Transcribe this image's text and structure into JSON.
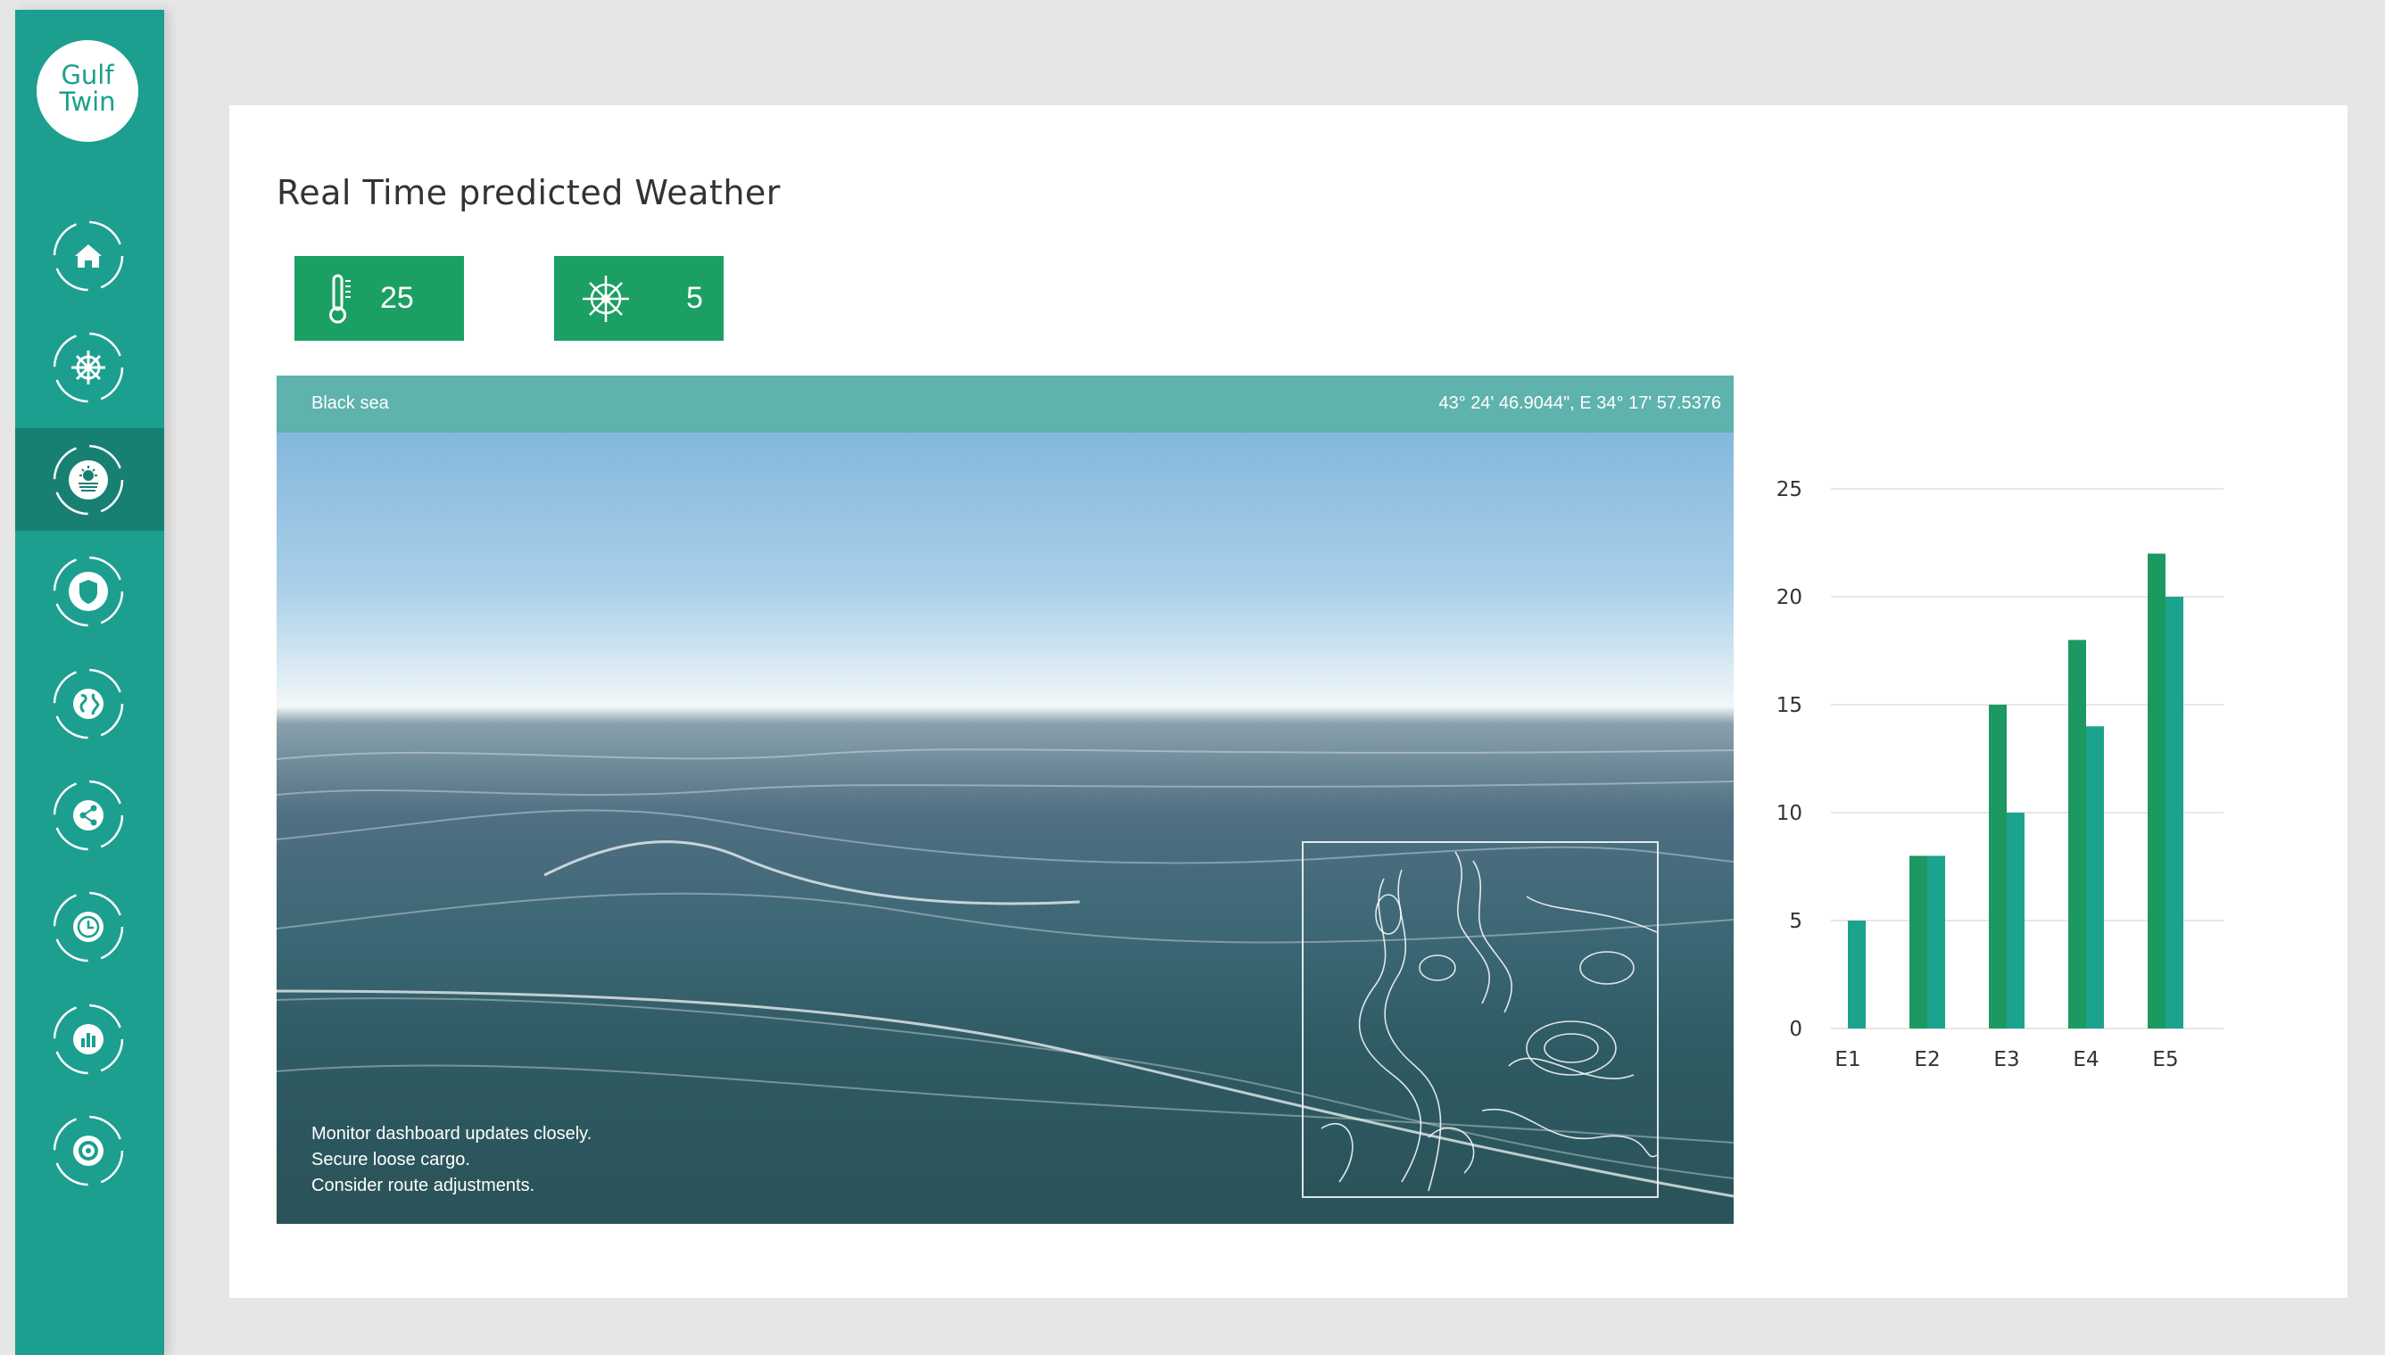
{
  "app": {
    "logo_line1": "Gulf",
    "logo_line2": "Twin"
  },
  "sidebar": {
    "items": [
      {
        "icon": "home-icon",
        "active": false
      },
      {
        "icon": "ship-wheel-icon",
        "active": false
      },
      {
        "icon": "weather-sun-icon",
        "active": true
      },
      {
        "icon": "shield-icon",
        "active": false
      },
      {
        "icon": "globe-icon",
        "active": false
      },
      {
        "icon": "share-icon",
        "active": false
      },
      {
        "icon": "clock-icon",
        "active": false
      },
      {
        "icon": "bar-chart-icon",
        "active": false
      },
      {
        "icon": "gear-icon",
        "active": false
      }
    ]
  },
  "main": {
    "title": "Real Time predicted Weather",
    "metrics": {
      "temperature": {
        "icon": "thermometer-icon",
        "value": "25"
      },
      "wind": {
        "icon": "ship-wheel-icon",
        "value": "5"
      }
    },
    "sea_view": {
      "location": "Black sea",
      "coordinates": "43° 24' 46.9044\", E 34° 17' 57.5376",
      "advice": [
        "Monitor dashboard updates closely.",
        "Secure loose cargo.",
        "Consider route adjustments."
      ]
    }
  },
  "colors": {
    "sidebar": "#1c9f8f",
    "sidebar_active": "#178073",
    "metric_bg": "#1c9f63",
    "series_a": "#1c9960",
    "series_b": "#1ca38e"
  },
  "chart_data": {
    "type": "bar",
    "categories": [
      "E1",
      "E2",
      "E3",
      "E4",
      "E5"
    ],
    "series": [
      {
        "values": [
          0,
          8,
          15,
          18,
          22
        ]
      },
      {
        "values": [
          5,
          8,
          10,
          14,
          20
        ]
      }
    ],
    "ylim": [
      0,
      25
    ],
    "yticks": [
      0,
      5,
      10,
      15,
      20,
      25
    ],
    "grid": true
  }
}
